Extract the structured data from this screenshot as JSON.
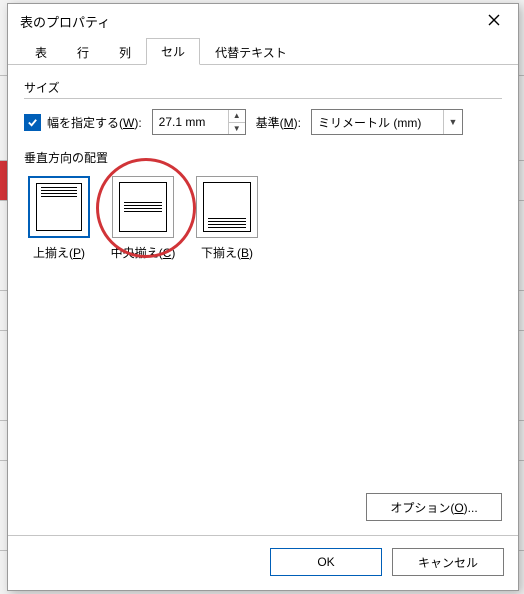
{
  "bg": {
    "row_y": [
      75,
      160,
      200,
      290,
      330,
      420,
      460,
      550
    ]
  },
  "dialog": {
    "title": "表のプロパティ"
  },
  "tabs": {
    "items": [
      {
        "label": "表",
        "selected": false
      },
      {
        "label": "行",
        "selected": false
      },
      {
        "label": "列",
        "selected": false
      },
      {
        "label": "セル",
        "selected": true
      },
      {
        "label": "代替テキスト",
        "selected": false
      }
    ]
  },
  "size": {
    "section_label": "サイズ",
    "specify_width_pre": "幅を指定する(",
    "specify_width_accel": "W",
    "specify_width_post": "):",
    "specify_width_checked": true,
    "width_value": "27.1 mm",
    "measure_label_pre": "基準(",
    "measure_label_accel": "M",
    "measure_label_post": "):",
    "measure_value": "ミリメートル (mm)"
  },
  "valign": {
    "section_label": "垂直方向の配置",
    "items": [
      {
        "caption_pre": "上揃え(",
        "accel": "P",
        "caption_post": ")",
        "pos": "top",
        "selected": true
      },
      {
        "caption_pre": "中央揃え(",
        "accel": "C",
        "caption_post": ")",
        "pos": "middle",
        "selected": false
      },
      {
        "caption_pre": "下揃え(",
        "accel": "B",
        "caption_post": ")",
        "pos": "bottom",
        "selected": false
      }
    ],
    "highlight_index": 1
  },
  "buttons": {
    "options_pre": "オプション(",
    "options_accel": "O",
    "options_post": ")...",
    "ok": "OK",
    "cancel": "キャンセル"
  }
}
